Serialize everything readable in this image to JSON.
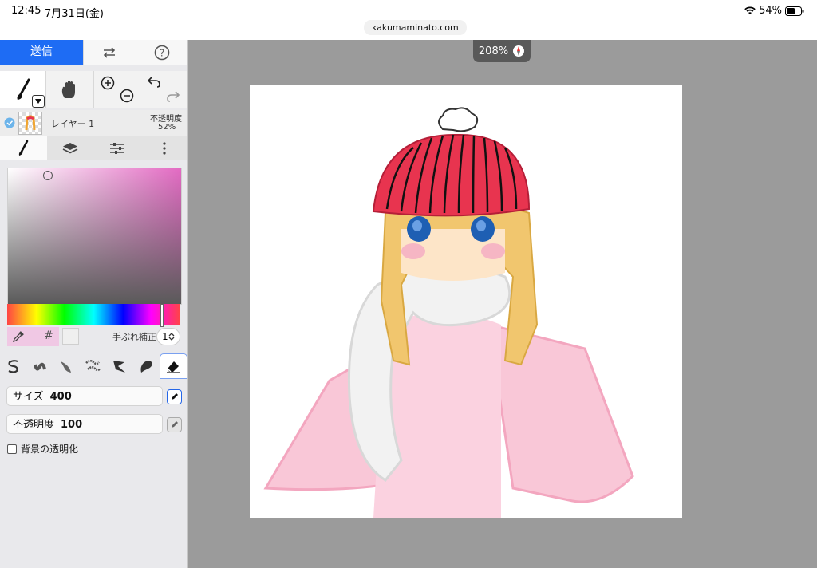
{
  "status": {
    "time": "12:45",
    "date": "7月31日(金)",
    "battery": "54%"
  },
  "browser": {
    "url": "kakumaminato.com"
  },
  "toolbar": {
    "send_label": "送信"
  },
  "layer": {
    "name": "レイヤー 1",
    "opacity_label": "不透明度",
    "opacity_value": "52%"
  },
  "stabilizer": {
    "label": "手ぶれ補正",
    "value": "1"
  },
  "color": {
    "hash_symbol": "#"
  },
  "brush_settings": {
    "size_label": "サイズ",
    "size_value": "400",
    "opacity_label": "不透明度",
    "opacity_value": "100",
    "transparent_bg_label": "背景の透明化"
  },
  "canvas": {
    "zoom": "208%"
  },
  "colors": {
    "accent": "#1e6cf4",
    "hat": "#e8344f",
    "dress": "#f7c4d6",
    "hair": "#f0c56a"
  }
}
